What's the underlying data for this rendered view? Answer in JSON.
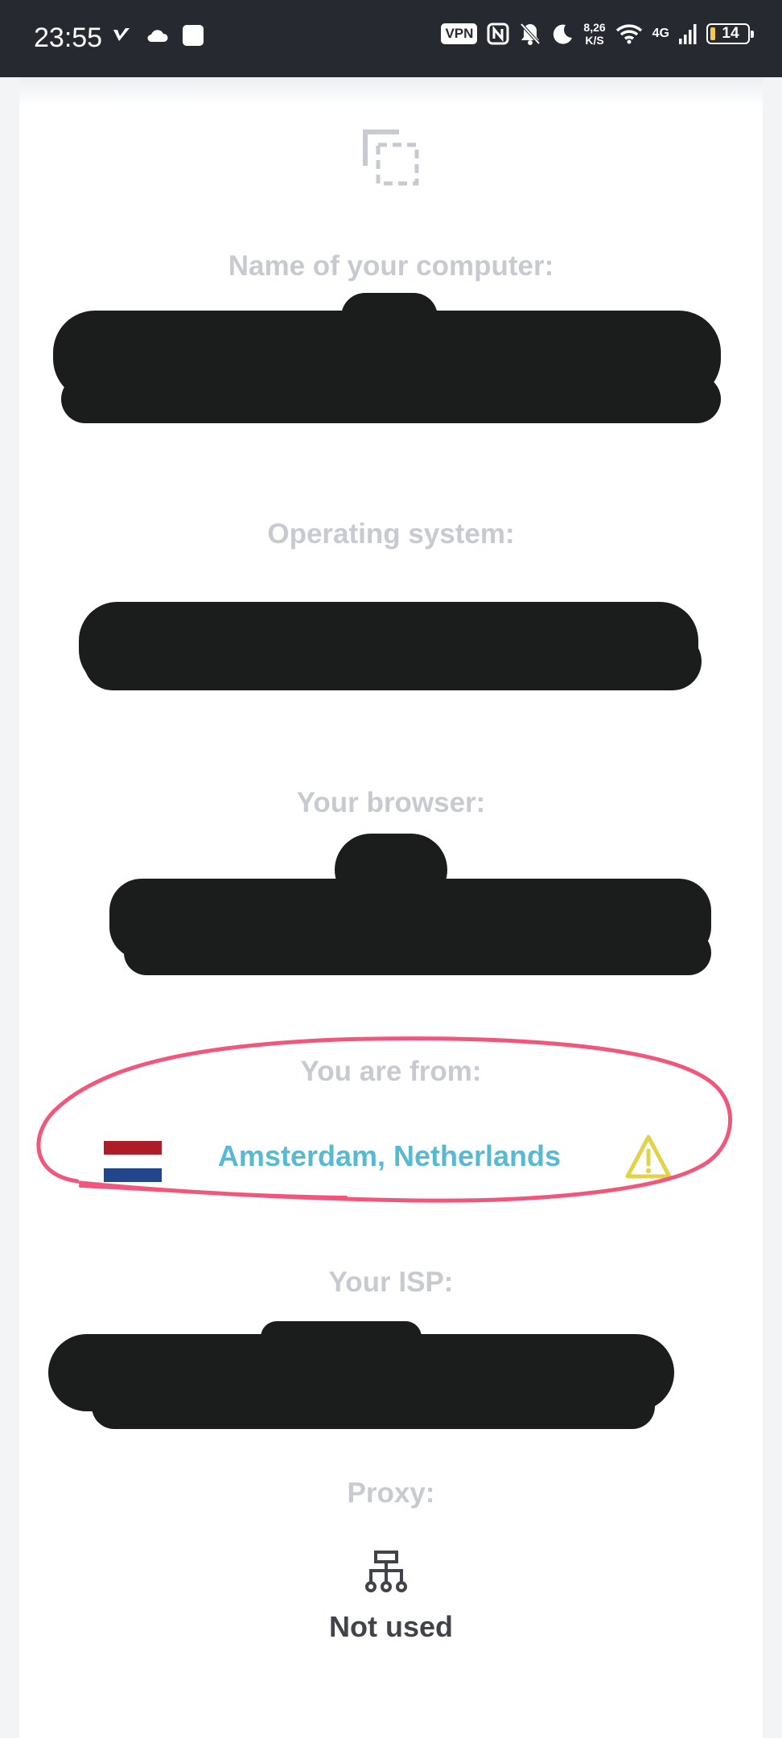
{
  "status_bar": {
    "time": "23:55",
    "vpn_label": "VPN",
    "speed_value": "8,26",
    "speed_unit": "K/S",
    "network": "4G",
    "battery": "14"
  },
  "labels": {
    "computer_name": "Name of your computer:",
    "operating_system": "Operating system:",
    "browser": "Your browser:",
    "location": "You are from:",
    "isp": "Your ISP:",
    "proxy": "Proxy:"
  },
  "location": {
    "value": "Amsterdam, Netherlands",
    "flag_colors": [
      "#ae1c28",
      "#ffffff",
      "#21468b"
    ],
    "warning_icon": "warning-triangle-icon"
  },
  "proxy": {
    "value": "Not used",
    "icon": "network-tree-icon"
  },
  "colors": {
    "label": "#c7cad0",
    "location_text": "#58b9d3",
    "warning": "#e3d146",
    "annotation_circle": "#f2567a",
    "redaction": "#1b1c1c"
  }
}
